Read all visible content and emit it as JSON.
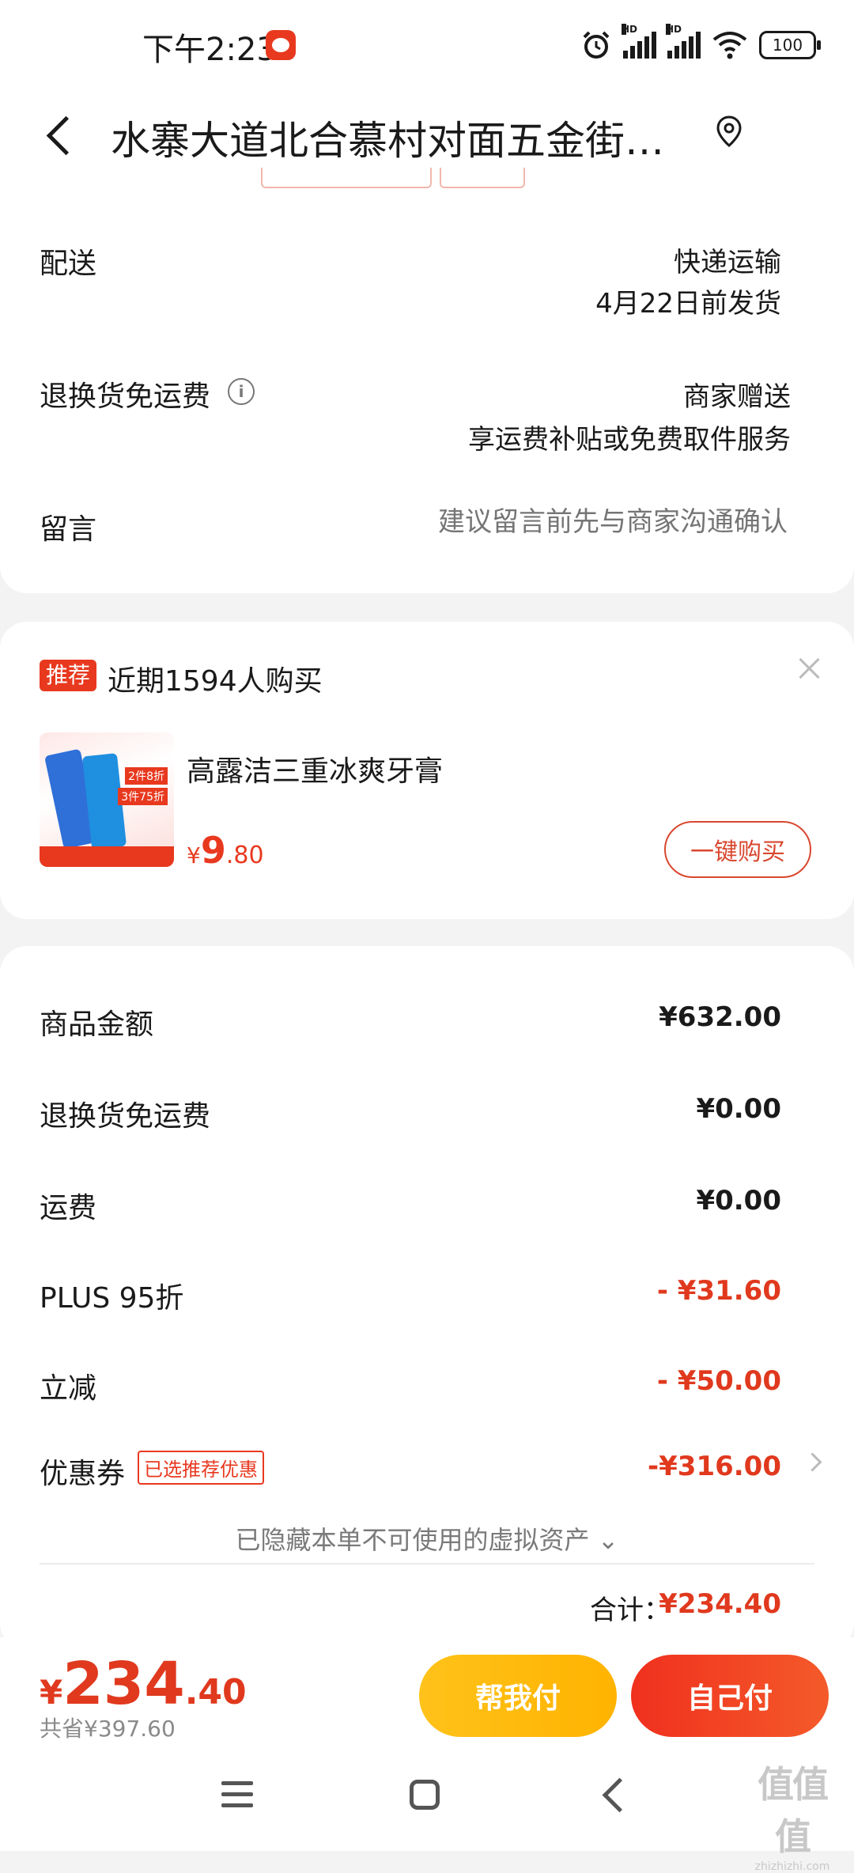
{
  "status_bar": {
    "time": "下午2:23",
    "hd_label": "HD",
    "battery": "100",
    "icons": [
      "alarm-icon",
      "signal-icon",
      "signal-icon",
      "wifi-icon",
      "battery-icon"
    ]
  },
  "header": {
    "title": "水寨大道北合慕村对面五金街…",
    "back_icon": "chevron-left-icon",
    "location_icon": "location-icon"
  },
  "shipping": {
    "delivery_label": "配送",
    "delivery_method": "快递运输",
    "delivery_date": "4月22日前发货",
    "return_label": "退换货免运费",
    "return_value": "商家赠送",
    "return_detail": "享运费补贴或免费取件服务",
    "message_label": "留言",
    "message_placeholder": "建议留言前先与商家沟通确认"
  },
  "recommend": {
    "badge": "推荐",
    "text": "近期1594人购买",
    "product_name": "高露洁三重冰爽牙膏",
    "price_symbol": "¥",
    "price_int": "9",
    "price_dec": ".80",
    "buy_label": "一键购买",
    "thumb_tag1": "2件8折",
    "thumb_tag2": "3件75折"
  },
  "summary": {
    "rows": [
      {
        "label": "商品金额",
        "value": "¥632.00"
      },
      {
        "label": "退换货免运费",
        "value": "¥0.00"
      },
      {
        "label": "运费",
        "value": "¥0.00"
      },
      {
        "label": "PLUS 95折",
        "value": "- ¥31.60"
      },
      {
        "label": "立减",
        "value": "- ¥50.00"
      },
      {
        "label": "优惠券",
        "value": "-¥316.00"
      }
    ],
    "coupon_tag": "已选推荐优惠",
    "hidden_note": "已隐藏本单不可使用的虚拟资产 ⌄",
    "total_label": "合计：",
    "total_value": "¥234.40"
  },
  "bottom": {
    "price_symbol": "¥",
    "price_int": "234",
    "price_dec": ".40",
    "saved": "共省¥397.60",
    "help_pay": "帮我付",
    "self_pay": "自己付"
  },
  "watermark": {
    "main": "值值值",
    "sub": "zhizhizhi.com"
  },
  "colors": {
    "accent_red": "#e0391e",
    "help_yellow": "#ffb300",
    "background": "#f3f3f3"
  }
}
